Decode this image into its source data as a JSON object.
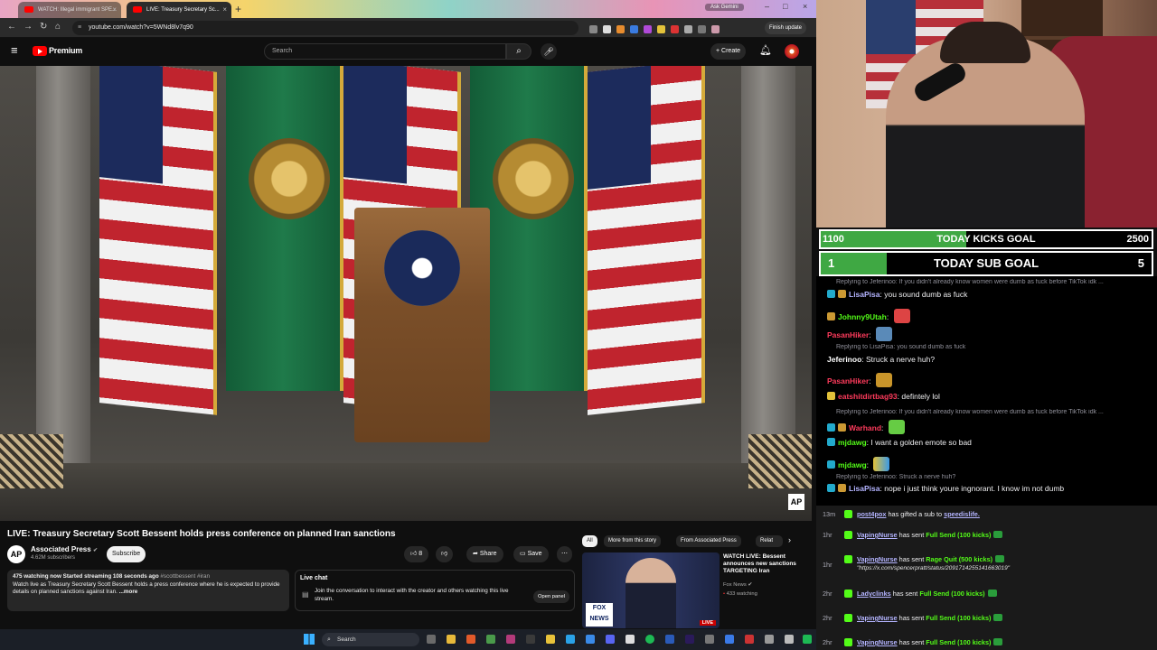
{
  "browser": {
    "tabs": [
      {
        "title": "WATCH: Illegal immigrant SPE..."
      },
      {
        "title": "LIVE: Treasury Secretary Sc..."
      }
    ],
    "url": "youtube.com/watch?v=5WNd8lv7q90",
    "ask_gemini": "Ask Gemini",
    "finish_update": "Finish update"
  },
  "youtube": {
    "brand": "Premium",
    "search_placeholder": "Search",
    "create_label": "Create",
    "video": {
      "title": "LIVE: Treasury Secretary Scott Bessent holds press conference on planned Iran sanctions",
      "channel": "Associated Press",
      "channel_logo": "AP",
      "subscribers": "4.62M subscribers",
      "subscribe_label": "Subscribe",
      "likes": "8",
      "share_label": "Share",
      "save_label": "Save",
      "watermark": "AP"
    },
    "description": {
      "meta": "475 watching now  Started streaming 108 seconds ago",
      "tags": "#scottbessent #iran",
      "text": "Watch live as Treasury Secretary Scott Bessent holds a press conference where he is expected to provide details on planned sanctions against Iran.",
      "more": "...more"
    },
    "live_chat": {
      "heading": "Live chat",
      "text": "Join the conversation to interact with the creator and others watching this live stream.",
      "button": "Open panel"
    },
    "chips": [
      "All",
      "More from this story",
      "From Associated Press",
      "Relat"
    ],
    "related": {
      "title": "WATCH LIVE: Bessent announces new sanctions TARGETING Iran",
      "source": "Fox News",
      "watching": "433 watching",
      "badge": "LIVE",
      "thumb_logo": "FOX NEWS"
    },
    "taskbar_search": "Search"
  },
  "overlay": {
    "goals": [
      {
        "left": "1100",
        "label": "TODAY KICKS GOAL",
        "right": "2500",
        "progress": 0.44
      },
      {
        "left": "1",
        "label": "TODAY SUB GOAL",
        "right": "5",
        "progress": 0.2
      }
    ],
    "chat": [
      {
        "reply": "Replying to Jeferinoo: If you didn't already know women were dumb as fuck before TikTok idk ...",
        "user": "LisaPisa",
        "color": "#b4b4ff",
        "text": "you sound dumb as fuck"
      },
      {
        "user": "Johnny9Utah",
        "color": "#53fc18",
        "text": ""
      },
      {
        "user": "PasanHiker",
        "color": "#ff3b5c",
        "text": ""
      },
      {
        "reply": "Replying to LisaPisa: you sound dumb as fuck",
        "user": "Jeferinoo",
        "color": "#ffffff",
        "text": "Struck a nerve huh?"
      },
      {
        "user": "PasanHiker",
        "color": "#ff3b5c",
        "text": ""
      },
      {
        "user": "eatshitdirtbag93",
        "color": "#ff3b5c",
        "text": "defintely lol"
      },
      {
        "reply": "Replying to Jeferinoo: If you didn't already know women were dumb as fuck before TikTok idk ...",
        "user": "Warhand",
        "color": "#ff3b5c",
        "text": ""
      },
      {
        "user": "mjdawg",
        "color": "#53fc18",
        "text": "I want a golden emote so bad"
      },
      {
        "user": "mjdawg",
        "color": "#53fc18",
        "text": ""
      },
      {
        "reply": "Replying to Jeferinoo: Struck a nerve huh?",
        "user": "LisaPisa",
        "color": "#b4b4ff",
        "text": "nope i just think youre ingnorant. I know im not dumb"
      }
    ],
    "events": [
      {
        "time": "13m",
        "user": "post4pox",
        "pre": "has gifted a sub to",
        "gift": "speedislife.",
        "post": ""
      },
      {
        "time": "1hr",
        "user": "VapingNurse",
        "pre": "has sent",
        "gift": "Full Send (100 kicks)",
        "post": ""
      },
      {
        "time": "1hr",
        "user": "VapingNurse",
        "pre": "has sent",
        "gift": "Rage Quit (500 kicks)",
        "post": "\"https://x.com/spencerpratt/status/2091714255141663019\""
      },
      {
        "time": "2hr",
        "user": "Ladyclinks",
        "pre": "has sent",
        "gift": "Full Send (100 kicks)",
        "post": ""
      },
      {
        "time": "2hr",
        "user": "VapingNurse",
        "pre": "has sent",
        "gift": "Full Send (100 kicks)",
        "post": ""
      },
      {
        "time": "2hr",
        "user": "VapingNurse",
        "pre": "has sent",
        "gift": "Full Send (100 kicks)",
        "post": ""
      }
    ]
  },
  "colors": {
    "kick_green": "#53fc18",
    "youtube_red": "#ff0000",
    "goal_fill": "#3fa843"
  }
}
